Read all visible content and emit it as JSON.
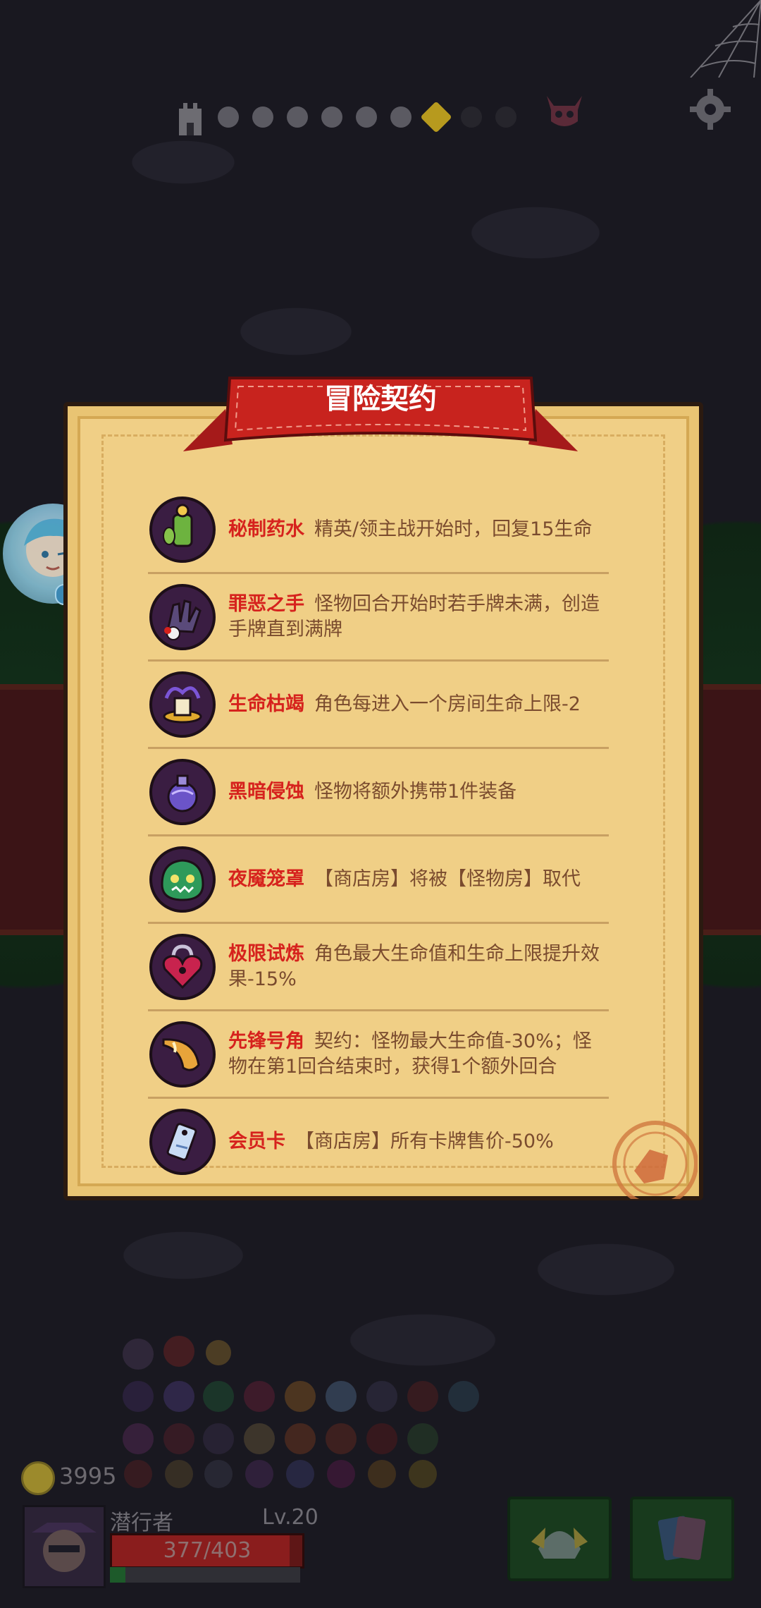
{
  "dialog": {
    "title": "冒险契约",
    "contracts": [
      {
        "name": "秘制药水",
        "desc": "精英/领主战开始时，回复15生命",
        "icon": "potion-icon"
      },
      {
        "name": "罪恶之手",
        "desc": "怪物回合开始时若手牌未满，创造手牌直到满牌",
        "icon": "sinful-hand-icon"
      },
      {
        "name": "生命枯竭",
        "desc": "角色每进入一个房间生命上限-2",
        "icon": "withered-life-icon"
      },
      {
        "name": "黑暗侵蚀",
        "desc": "怪物将额外携带1件装备",
        "icon": "dark-flask-icon"
      },
      {
        "name": "夜魇笼罩",
        "desc": "【商店房】将被【怪物房】取代",
        "icon": "nightmare-monster-icon"
      },
      {
        "name": "极限试炼",
        "desc": "角色最大生命值和生命上限提升效果-15%",
        "icon": "heart-lock-icon"
      },
      {
        "name": "先锋号角",
        "desc": "契约：怪物最大生命值-30%；怪物在第1回合结束时，获得1个额外回合",
        "icon": "horn-icon"
      },
      {
        "name": "会员卡",
        "desc": "【商店房】所有卡牌售价-50%",
        "icon": "member-card-icon"
      }
    ]
  },
  "player": {
    "name": "潜行者",
    "level": "Lv.20",
    "hp_text": "377/403",
    "hp_fraction": 0.935,
    "xp_fraction": 0.08,
    "gold": "3995"
  },
  "progress": {
    "total_nodes": 9,
    "current_index": 6
  },
  "assistant": {
    "more": "•••"
  },
  "colors": {
    "contract_name": "#d6221d",
    "contract_desc": "#7a4b2e",
    "ribbon": "#c8231e",
    "parchment": "#f0cf86"
  }
}
